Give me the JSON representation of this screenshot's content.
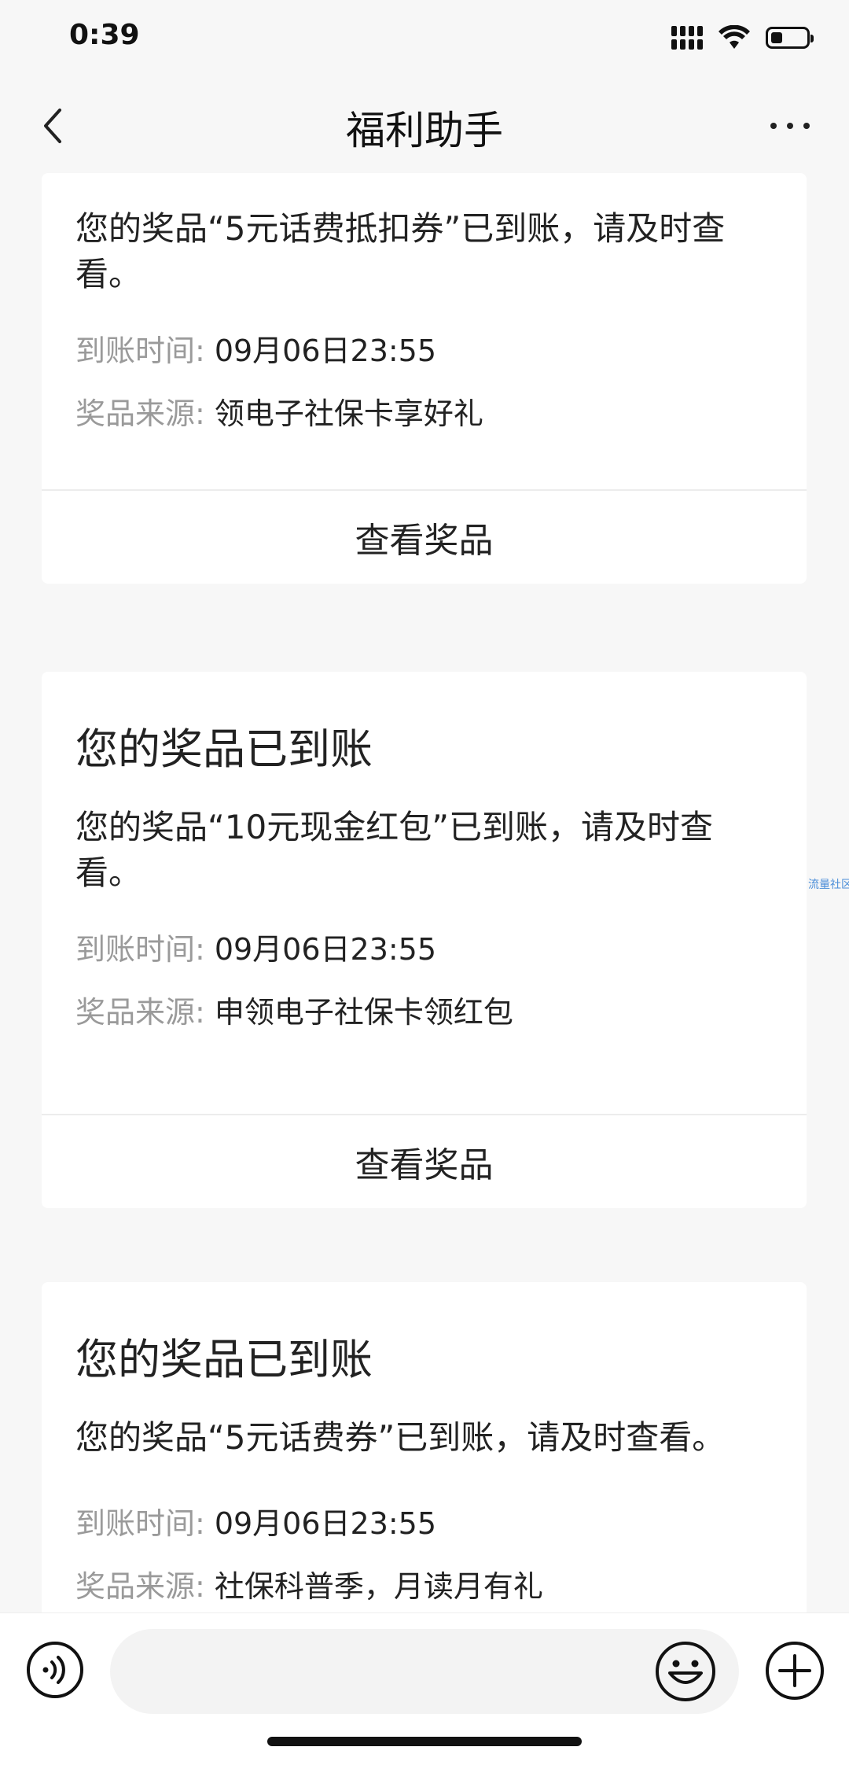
{
  "status_bar": {
    "time": "0:39"
  },
  "header": {
    "title": "福利助手"
  },
  "cards": [
    {
      "title": "",
      "message": "您的奖品“5元话费抵扣券”已到账，请及时查看。",
      "arrival_time_label": "到账时间:",
      "arrival_time": "09月06日23:55",
      "source_label": "奖品来源:",
      "source": "领电子社保卡享好礼",
      "action_label": "查看奖品"
    },
    {
      "title": "您的奖品已到账",
      "message": "您的奖品“10元现金红包”已到账，请及时查看。",
      "arrival_time_label": "到账时间:",
      "arrival_time": "09月06日23:55",
      "source_label": "奖品来源:",
      "source": "申领电子社保卡领红包",
      "action_label": "查看奖品"
    },
    {
      "title": "您的奖品已到账",
      "message": "您的奖品“5元话费券”已到账，请及时查看。",
      "arrival_time_label": "到账时间:",
      "arrival_time": "09月06日23:55",
      "source_label": "奖品来源:",
      "source": "社保科普季，月读月有礼"
    }
  ],
  "side_watermark": "流量社区",
  "icons": {
    "back": "back-chevron-icon",
    "more": "more-dots-icon",
    "voice": "voice-icon",
    "emoji": "emoji-icon",
    "plus": "plus-icon"
  }
}
